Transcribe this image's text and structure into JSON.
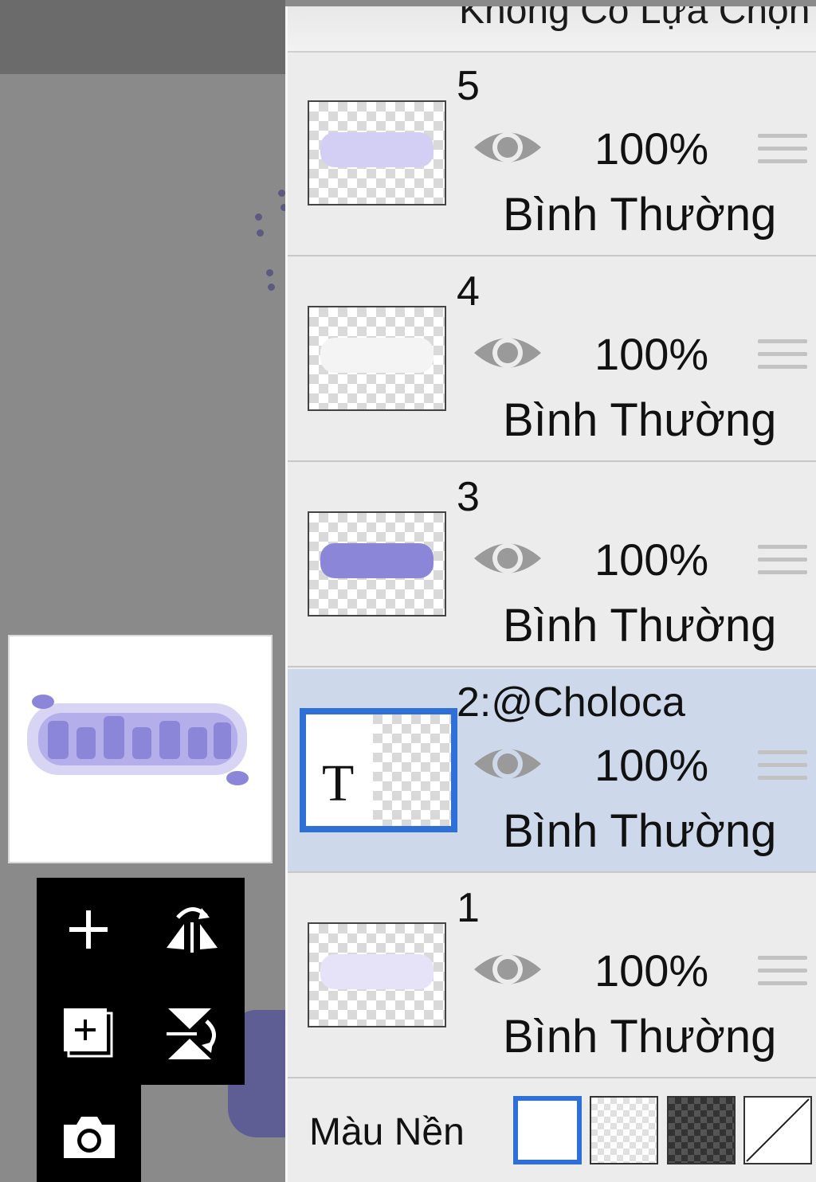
{
  "panel": {
    "header_text": "Không Có Lựa Chọn"
  },
  "layers": [
    {
      "name": "5",
      "opacity": "100%",
      "blend_mode": "Bình Thường",
      "visible": true,
      "selected": false
    },
    {
      "name": "4",
      "opacity": "100%",
      "blend_mode": "Bình Thường",
      "visible": true,
      "selected": false
    },
    {
      "name": "3",
      "opacity": "100%",
      "blend_mode": "Bình Thường",
      "visible": true,
      "selected": false
    },
    {
      "name": "2:@Choloca",
      "opacity": "100%",
      "blend_mode": "Bình Thường",
      "visible": true,
      "selected": true,
      "type_glyph": "T"
    },
    {
      "name": "1",
      "opacity": "100%",
      "blend_mode": "Bình Thường",
      "visible": true,
      "selected": false
    }
  ],
  "background": {
    "label": "Màu Nền",
    "options": [
      "white",
      "transparent-light",
      "transparent-dark",
      "none"
    ],
    "selected": "white"
  },
  "toolbar": {
    "icons": [
      "plus-icon",
      "flip-horizontal-icon",
      "add-layer-icon",
      "flip-vertical-icon",
      "camera-icon"
    ]
  },
  "colors": {
    "accent": "#2f6fd8",
    "selected_row": "#cdd9eb",
    "art_purple": "#8c86d8"
  }
}
